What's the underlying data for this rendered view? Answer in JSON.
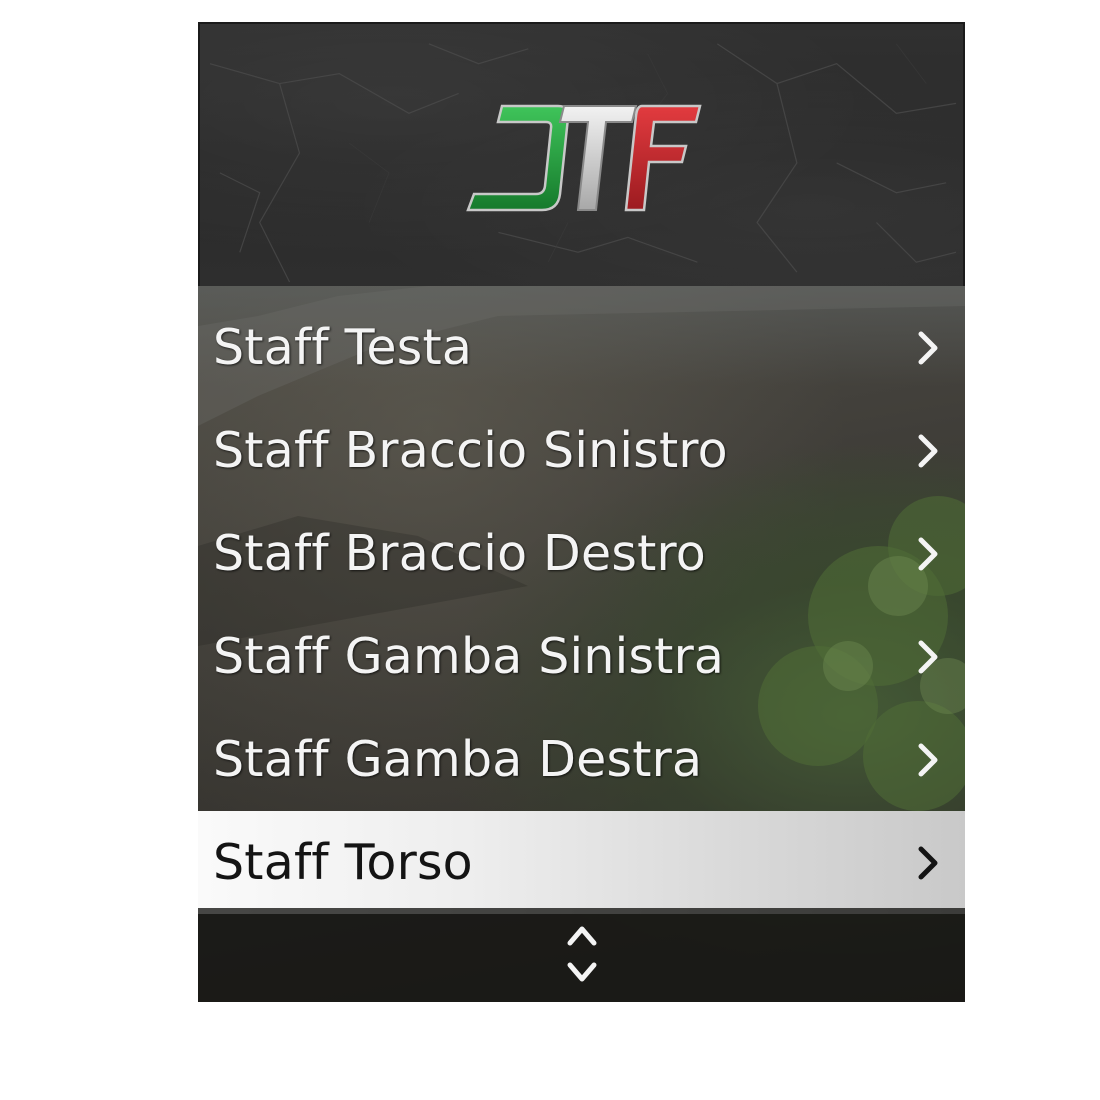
{
  "header": {
    "logo_text": "DTF",
    "logo_icon": "dtf-logo",
    "logo_colors": [
      "#1f9a3a",
      "#d9d9d9",
      "#c8262c"
    ]
  },
  "menu": {
    "items": [
      {
        "label": "Staff Testa",
        "icon": "chevron-right-icon",
        "selected": false
      },
      {
        "label": "Staff Braccio Sinistro",
        "icon": "chevron-right-icon",
        "selected": false
      },
      {
        "label": "Staff Braccio Destro",
        "icon": "chevron-right-icon",
        "selected": false
      },
      {
        "label": "Staff Gamba Sinistra",
        "icon": "chevron-right-icon",
        "selected": false
      },
      {
        "label": "Staff Gamba Destra",
        "icon": "chevron-right-icon",
        "selected": false
      },
      {
        "label": "Staff Torso",
        "icon": "chevron-right-icon",
        "selected": true
      }
    ],
    "selected_color": "#f2f2f2",
    "text_color": "#f4f4f4"
  },
  "footer": {
    "icon": "up-down-arrows-icon"
  }
}
